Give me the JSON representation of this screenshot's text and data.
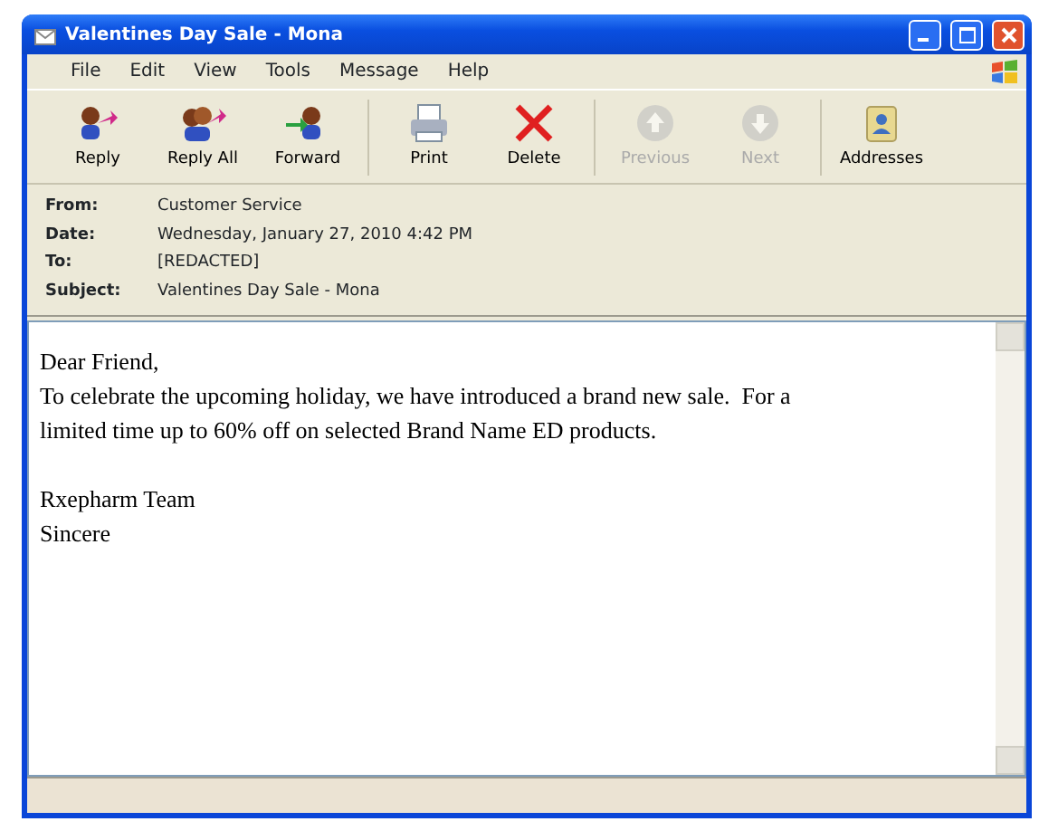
{
  "window": {
    "title": "Valentines Day Sale - Mona"
  },
  "menu": [
    "File",
    "Edit",
    "View",
    "Tools",
    "Message",
    "Help"
  ],
  "toolbar": [
    {
      "kind": "reply",
      "label": "Reply",
      "disabled": false
    },
    {
      "kind": "reply-all",
      "label": "Reply All",
      "disabled": false
    },
    {
      "kind": "forward",
      "label": "Forward",
      "disabled": false
    },
    {
      "kind": "print",
      "label": "Print",
      "disabled": false
    },
    {
      "kind": "delete",
      "label": "Delete",
      "disabled": false
    },
    {
      "kind": "previous",
      "label": "Previous",
      "disabled": true
    },
    {
      "kind": "next",
      "label": "Next",
      "disabled": true
    },
    {
      "kind": "addresses",
      "label": "Addresses",
      "disabled": false
    }
  ],
  "headers": [
    {
      "label": "From:",
      "value": "Customer Service"
    },
    {
      "label": "Date:",
      "value": "Wednesday, January 27, 2010 4:42 PM"
    },
    {
      "label": "To:",
      "value": "[REDACTED]"
    },
    {
      "label": "Subject:",
      "value": "Valentines Day Sale - Mona"
    }
  ],
  "body": [
    [
      "Dear Friend,",
      "To celebrate the upcoming holiday, we have introduced a brand new sale.  For a",
      "limited time up to 60% off on selected Brand Name ED products."
    ],
    [
      "Rxepharm Team",
      "Sincere"
    ]
  ]
}
